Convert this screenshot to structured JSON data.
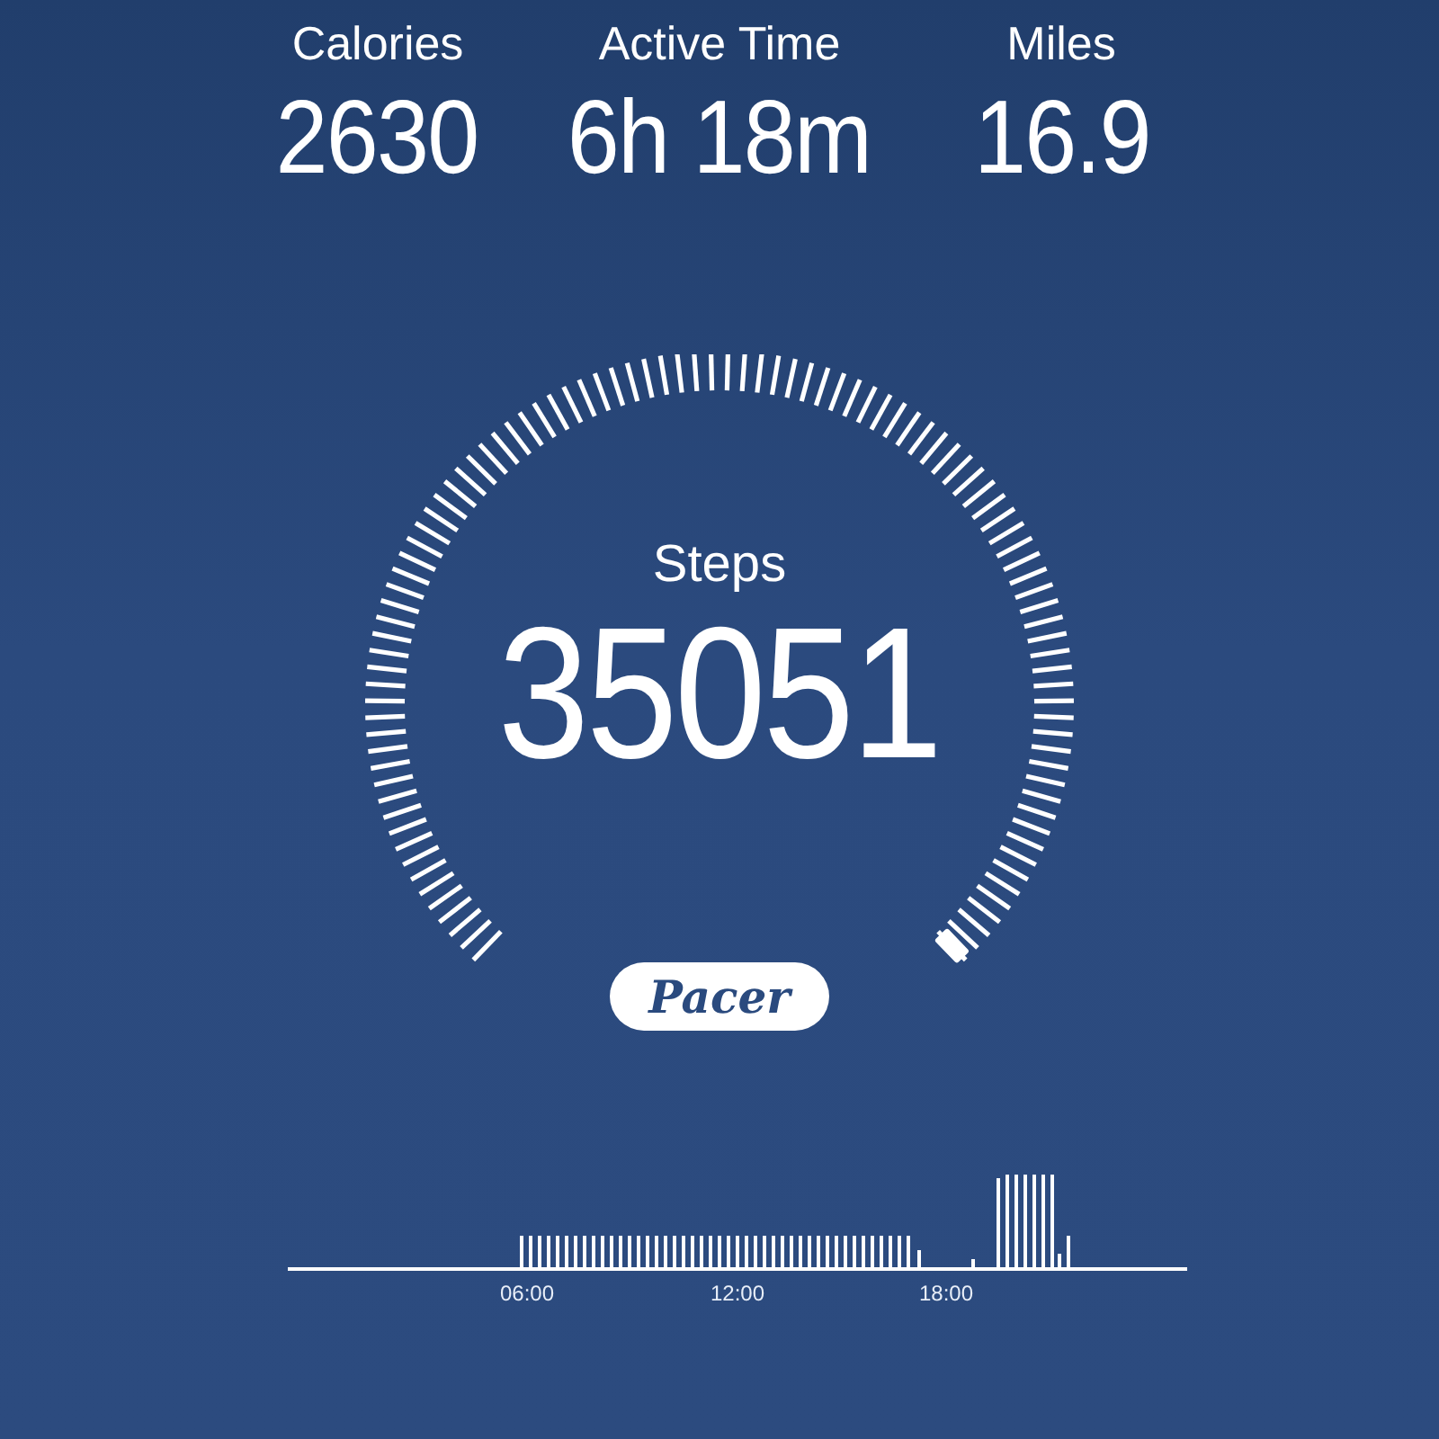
{
  "stats": [
    {
      "label": "Calories",
      "value": "2630"
    },
    {
      "label": "Active Time",
      "value": "6h 18m"
    },
    {
      "label": "Miles",
      "value": "16.9"
    }
  ],
  "steps": {
    "label": "Steps",
    "value": "35051"
  },
  "brand": "Pacer",
  "activity_chart": {
    "time_labels": [
      "06:00",
      "12:00",
      "18:00"
    ]
  }
}
